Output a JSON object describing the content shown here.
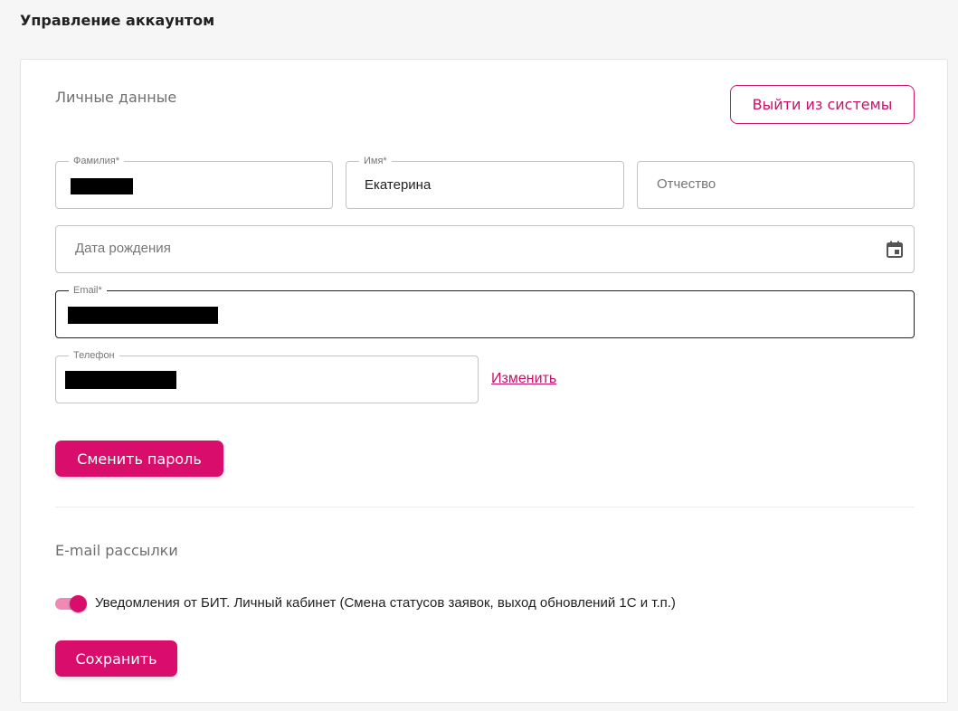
{
  "page": {
    "title": "Управление аккаунтом"
  },
  "personal": {
    "title": "Личные данные",
    "logout_label": "Выйти из системы",
    "surname": {
      "label": "Фамилия*"
    },
    "name": {
      "label": "Имя*",
      "value": "Екатерина"
    },
    "patronymic": {
      "placeholder": "Отчество"
    },
    "birthdate": {
      "placeholder": "Дата рождения",
      "icon": "calendar-icon"
    },
    "email": {
      "label": "Email*"
    },
    "phone": {
      "label": "Телефон",
      "change_label": "Изменить"
    },
    "change_password_label": "Сменить пароль"
  },
  "mailing": {
    "title": "E-mail рассылки",
    "toggle_label": "Уведомления от БИТ. Личный кабинет (Смена статусов заявок, выход обновлений 1С и т.п.)",
    "toggle_on": true,
    "save_label": "Сохранить"
  },
  "colors": {
    "accent": "#d80d6c",
    "accent_light": "#ee8ab4",
    "text_muted": "#6f6f6f"
  }
}
